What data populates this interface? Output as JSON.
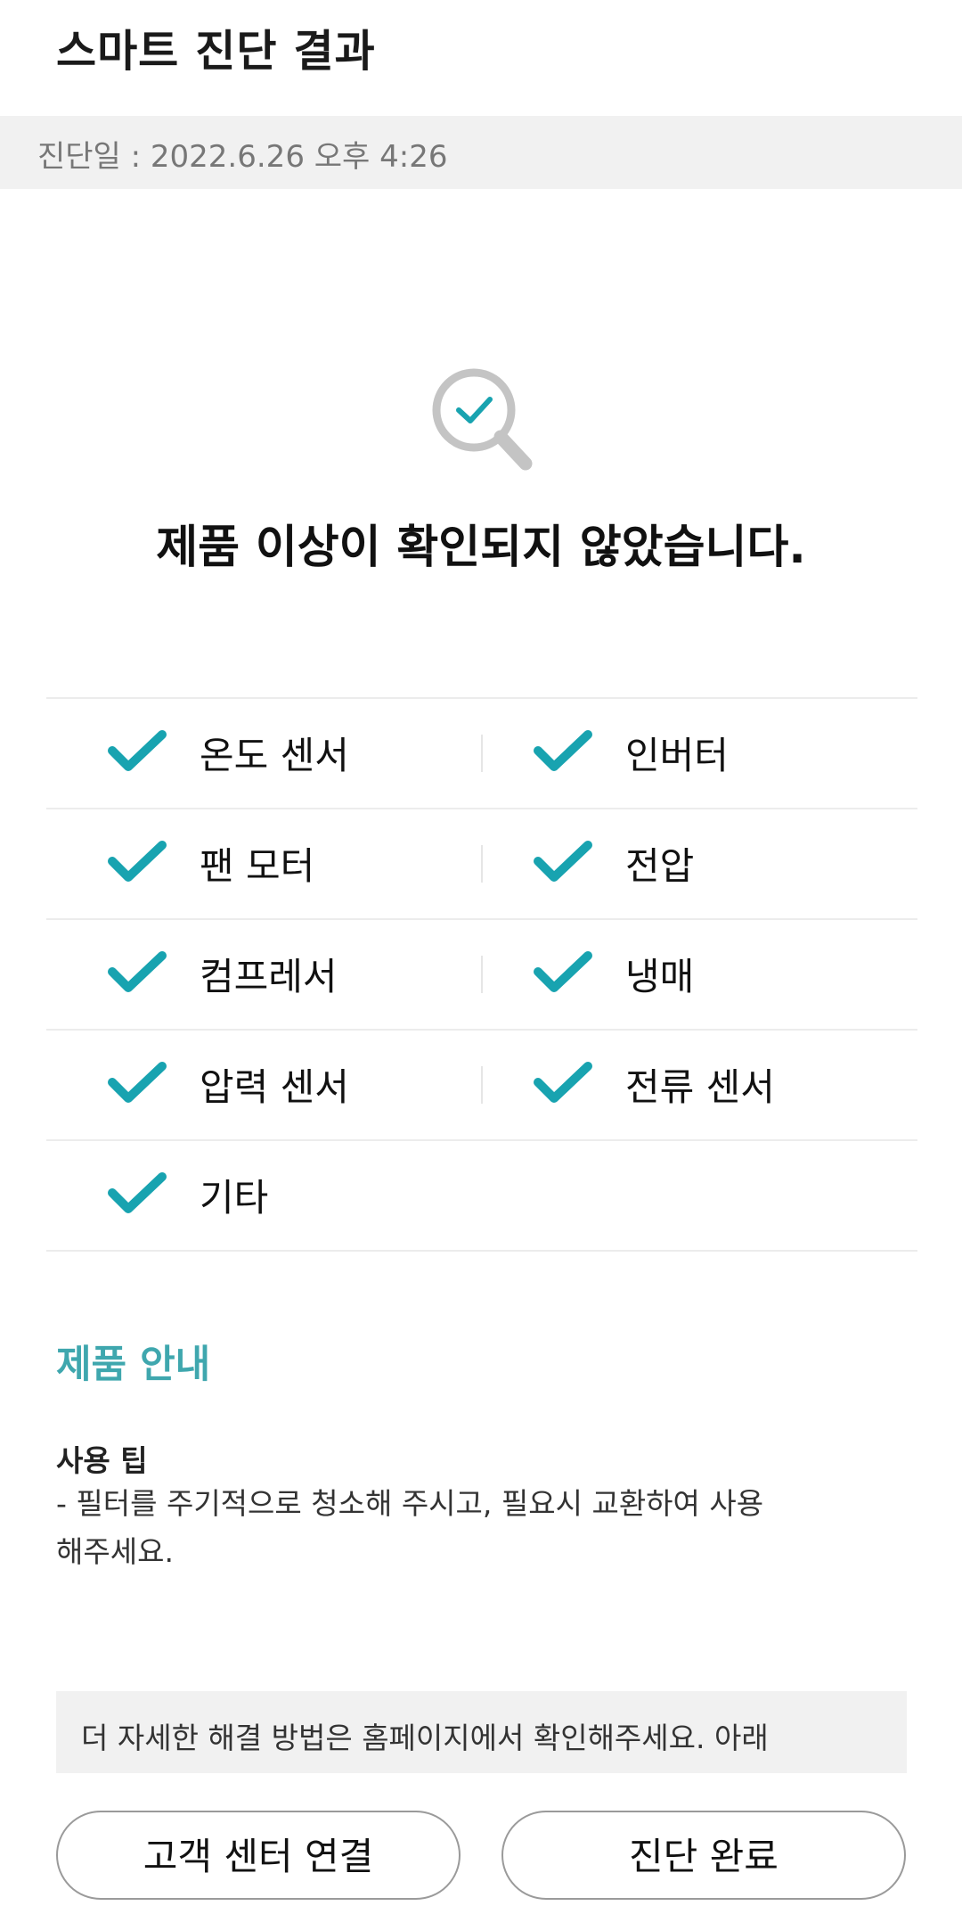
{
  "header": {
    "title": "스마트 진단 결과"
  },
  "diagnosis": {
    "date_text": "진단일 : 2022.6.26 오후 4:26"
  },
  "result": {
    "message": "제품 이상이 확인되지 않았습니다."
  },
  "checklist": [
    [
      "온도 센서",
      "인버터"
    ],
    [
      "팬 모터",
      "전압"
    ],
    [
      "컴프레서",
      "냉매"
    ],
    [
      "압력 센서",
      "전류 센서"
    ],
    [
      "기타"
    ]
  ],
  "product_info": {
    "title": "제품 안내",
    "tip_title": "사용 팁",
    "tip_body": "- 필터를 주기적으로 청소해 주시고, 필요시 교환하여 사용해주세요."
  },
  "info_box": {
    "text": "더 자세한 해결 방법은 홈페이지에서 확인해주세요. 아래"
  },
  "buttons": {
    "customer_center": "고객 센터 연결",
    "finish": "진단 완료"
  },
  "colors": {
    "accent": "#18a3b0",
    "section_title": "#3fa7ae",
    "icon_gray": "#c4c4c4"
  },
  "icons": {
    "result": "magnifier-check-icon",
    "item": "check-icon"
  }
}
